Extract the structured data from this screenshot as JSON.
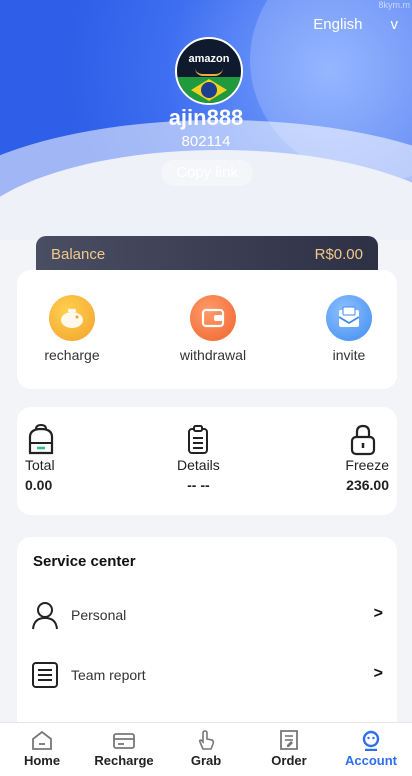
{
  "header": {
    "language": "English",
    "language_caret": "v",
    "watermark": "8kym.m",
    "avatar_text": "amazon",
    "username": "ajin888",
    "user_id": "802114",
    "copy_link": "Copy link"
  },
  "balance": {
    "label": "Balance",
    "value": "R$0.00"
  },
  "actions": [
    {
      "label": "recharge"
    },
    {
      "label": "withdrawal"
    },
    {
      "label": "invite"
    }
  ],
  "stats": [
    {
      "label": "Total",
      "value": "0.00"
    },
    {
      "label": "Details",
      "value": "-- --"
    },
    {
      "label": "Freeze",
      "value": "236.00"
    }
  ],
  "service": {
    "title": "Service center",
    "items": [
      {
        "label": "Personal",
        "arrow": ">"
      },
      {
        "label": "Team report",
        "arrow": ">"
      }
    ]
  },
  "tabbar": [
    {
      "label": "Home"
    },
    {
      "label": "Recharge"
    },
    {
      "label": "Grab"
    },
    {
      "label": "Order"
    },
    {
      "label": "Account"
    }
  ],
  "colors": {
    "accent": "#2f6ef0",
    "balance_text": "#f0c98a",
    "header": "#3b6cf0"
  }
}
